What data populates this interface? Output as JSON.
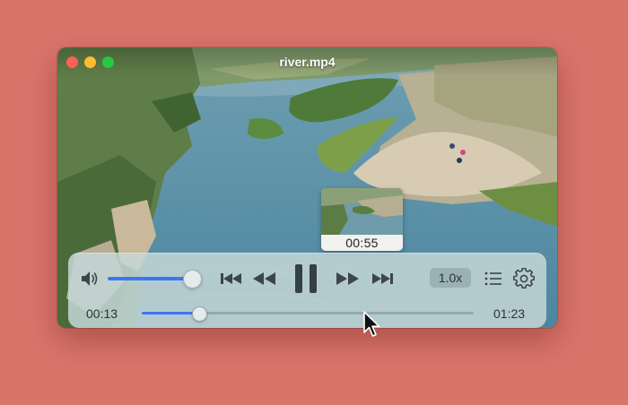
{
  "window": {
    "title": "river.mp4"
  },
  "preview": {
    "time": "00:55"
  },
  "controls": {
    "volume_level": 0.92,
    "playback_position": 0.14,
    "speed_label": "1.0x",
    "current_time": "00:13",
    "total_time": "01:23",
    "icons": [
      "speaker-icon",
      "skip-back-icon",
      "rewind-icon",
      "pause-icon",
      "fast-forward-icon",
      "skip-forward-icon",
      "playlist-icon",
      "settings-gear-icon"
    ]
  },
  "colors": {
    "desktop_background": "#d9746b",
    "accent_blue": "#3b78f0",
    "close_red": "#fe5f57",
    "minimize_yellow": "#febc2e",
    "maximize_green": "#28c840"
  }
}
